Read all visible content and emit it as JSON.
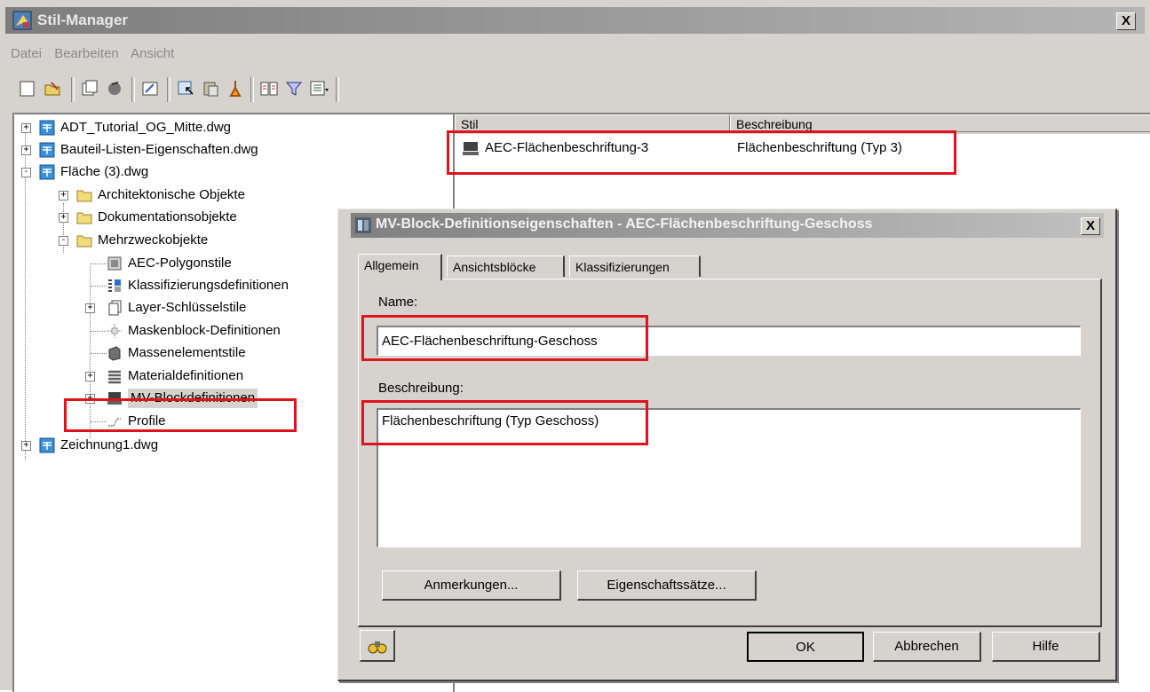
{
  "window": {
    "title": "Stil-Manager",
    "close_glyph": "X"
  },
  "menu": {
    "items": [
      "Datei",
      "Bearbeiten",
      "Ansicht"
    ]
  },
  "toolbar": {
    "icons": [
      "new-icon",
      "open-icon",
      "copy-icon",
      "purge-icon",
      "properties-icon",
      "set-from-icon",
      "paste-icon",
      "clean-icon",
      "compare-icon",
      "filter-icon",
      "view-icon"
    ]
  },
  "tree": {
    "items": [
      {
        "label": "ADT_Tutorial_OG_Mitte.dwg",
        "expander": "+"
      },
      {
        "label": "Bauteil-Listen-Eigenschaften.dwg",
        "expander": "+"
      },
      {
        "label": "Fläche (3).dwg",
        "expander": "-"
      },
      {
        "label": "Architektonische Objekte",
        "expander": "+"
      },
      {
        "label": "Dokumentationsobjekte",
        "expander": "+"
      },
      {
        "label": "Mehrzweckobjekte",
        "expander": "-"
      },
      {
        "label": "AEC-Polygonstile",
        "expander": ""
      },
      {
        "label": "Klassifizierungsdefinitionen",
        "expander": ""
      },
      {
        "label": "Layer-Schlüsselstile",
        "expander": "+"
      },
      {
        "label": "Maskenblock-Definitionen",
        "expander": ""
      },
      {
        "label": "Massenelementstile",
        "expander": ""
      },
      {
        "label": "Materialdefinitionen",
        "expander": "+"
      },
      {
        "label": "MV-Blockdefinitionen",
        "expander": "+"
      },
      {
        "label": "Profile",
        "expander": ""
      },
      {
        "label": "Zeichnung1.dwg",
        "expander": "+"
      }
    ]
  },
  "list": {
    "columns": [
      "Stil",
      "Beschreibung"
    ],
    "rows": [
      {
        "name": "AEC-Flächenbeschriftung-3",
        "description": "Flächenbeschriftung (Typ 3)"
      }
    ]
  },
  "dialog": {
    "title": "MV-Block-Definitionseigenschaften - AEC-Flächenbeschriftung-Geschoss",
    "close_glyph": "X",
    "tabs": [
      "Allgemein",
      "Ansichtsblöcke",
      "Klassifizierungen"
    ],
    "name_label": "Name:",
    "name_value": "AEC-Flächenbeschriftung-Geschoss",
    "description_label": "Beschreibung:",
    "description_value": "Flächenbeschriftung (Typ Geschoss)",
    "notes_button": "Anmerkungen...",
    "property_sets_button": "Eigenschaftssätze...",
    "ok_button": "OK",
    "cancel_button": "Abbrechen",
    "help_button": "Hilfe"
  },
  "colors": {
    "highlight": "#e0131a",
    "window_bg": "#d6d3ce"
  }
}
